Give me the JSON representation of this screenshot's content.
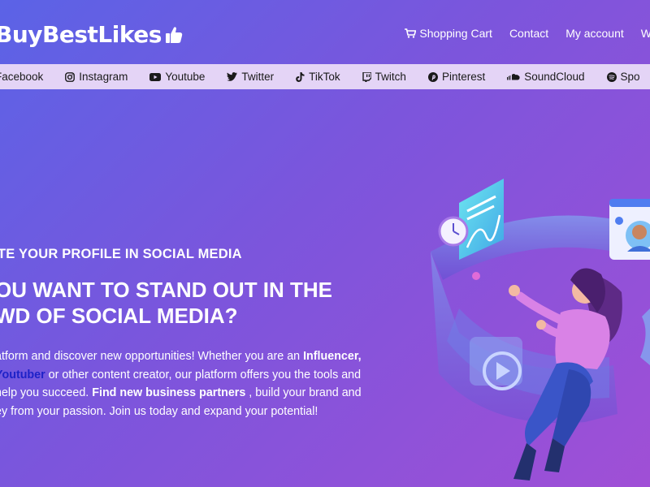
{
  "header": {
    "logo_text": "BuyBestLikes",
    "nav": [
      {
        "label": "Shopping Cart",
        "icon": "cart-icon"
      },
      {
        "label": "Contact"
      },
      {
        "label": "My account"
      },
      {
        "label": "W"
      }
    ]
  },
  "networks": [
    {
      "label": "Facebook",
      "icon": "facebook-icon"
    },
    {
      "label": "Instagram",
      "icon": "instagram-icon"
    },
    {
      "label": "Youtube",
      "icon": "youtube-icon"
    },
    {
      "label": "Twitter",
      "icon": "twitter-icon"
    },
    {
      "label": "TikTok",
      "icon": "tiktok-icon"
    },
    {
      "label": "Twitch",
      "icon": "twitch-icon"
    },
    {
      "label": "Pinterest",
      "icon": "pinterest-icon"
    },
    {
      "label": "SoundCloud",
      "icon": "soundcloud-icon"
    },
    {
      "label": "Spo",
      "icon": "spotify-icon"
    }
  ],
  "hero": {
    "eyebrow": "TE YOUR PROFILE IN SOCIAL MEDIA",
    "headline_line1": "OU WANT TO STAND OUT IN THE",
    "headline_line2": "WD OF SOCIAL MEDIA?",
    "p1a": "atform and discover new opportunities! Whether you are an ",
    "p1b": "Influencer,",
    "p2a": "Youtuber",
    "p2b": " or other content creator, our platform offers you the tools and",
    "p3a": " help you succeed.  ",
    "p3b": "Find new business partners",
    "p3c": " , build your brand and",
    "p4": "ey from your passion. Join us today and expand your potential!"
  }
}
